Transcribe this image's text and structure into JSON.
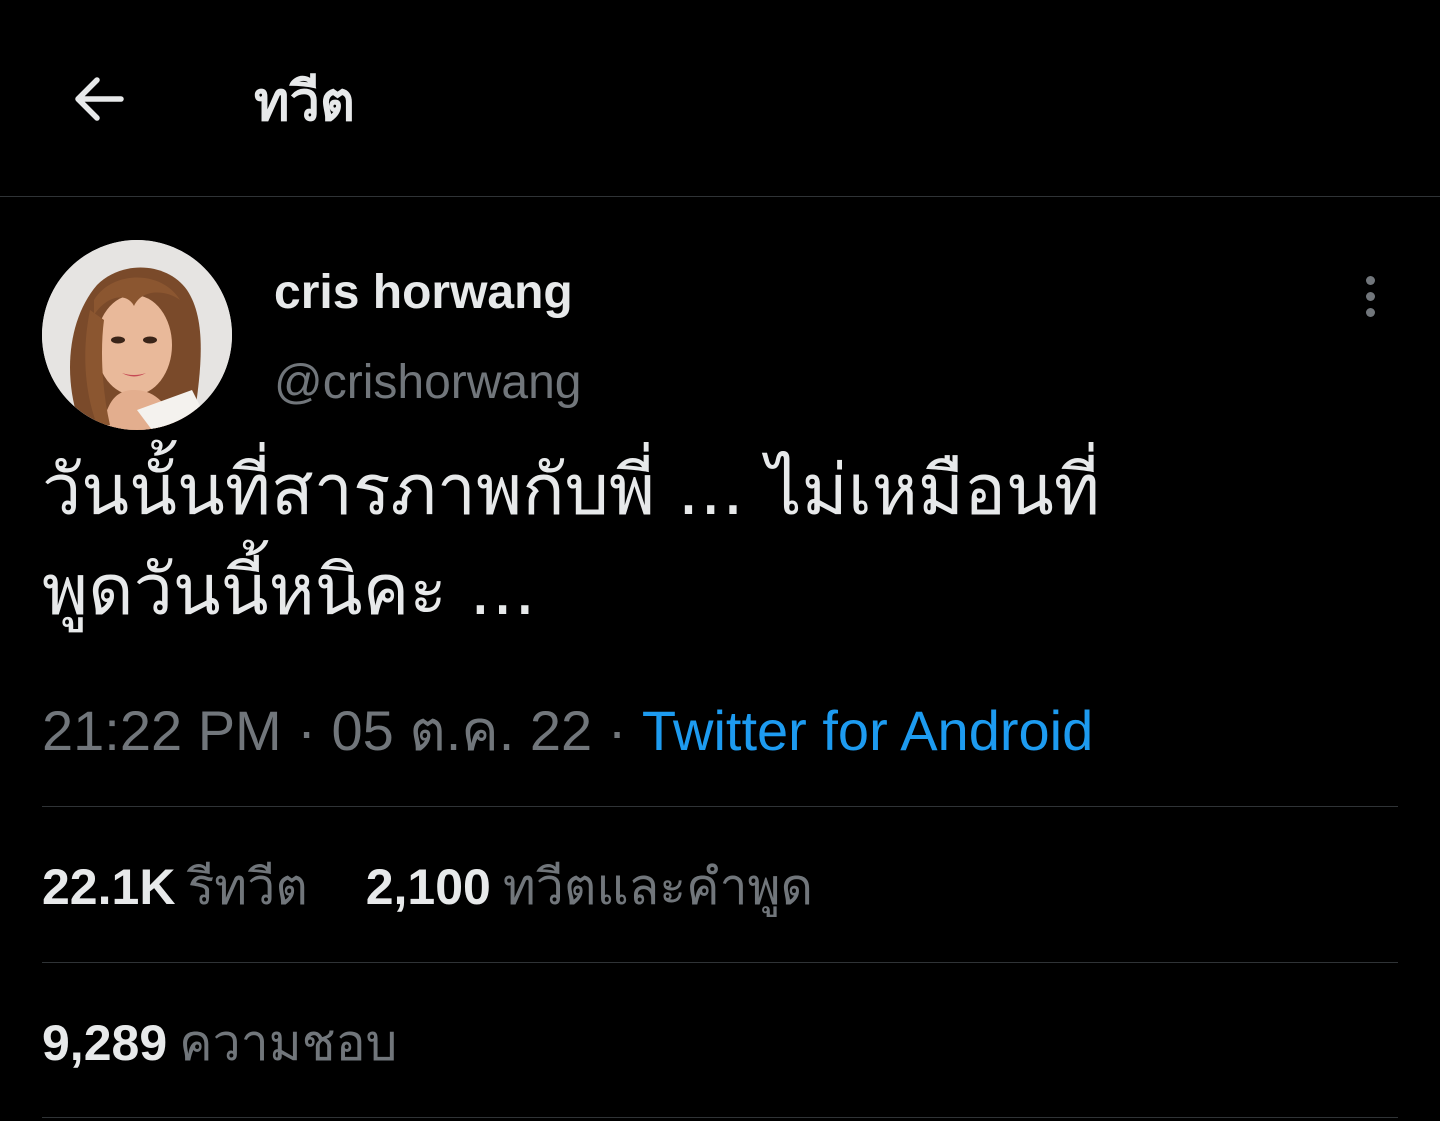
{
  "header": {
    "title": "ทวีต",
    "back_icon": "arrow-left-icon"
  },
  "tweet": {
    "author": {
      "display_name": "cris horwang",
      "handle": "@crishorwang"
    },
    "text_line1": "วันนั้นที่สารภาพกับพี่ ... ไม่เหมือนที่",
    "text_line2": "พูดวันนี้หนิคะ ...",
    "time": "21:22 PM",
    "separator": "·",
    "date": "05 ต.ค. 22",
    "source": "Twitter for Android",
    "more_icon": "more-vertical-icon"
  },
  "stats": {
    "retweets_count": "22.1K",
    "retweets_label": "รีทวีต",
    "quotes_count": "2,100",
    "quotes_label": "ทวีตและคำพูด",
    "likes_count": "9,289",
    "likes_label": "ความชอบ"
  },
  "colors": {
    "background": "#000000",
    "primary_text": "#e7e9ea",
    "secondary_text": "#71767b",
    "link": "#1d9bf0",
    "divider": "#2f3336"
  }
}
